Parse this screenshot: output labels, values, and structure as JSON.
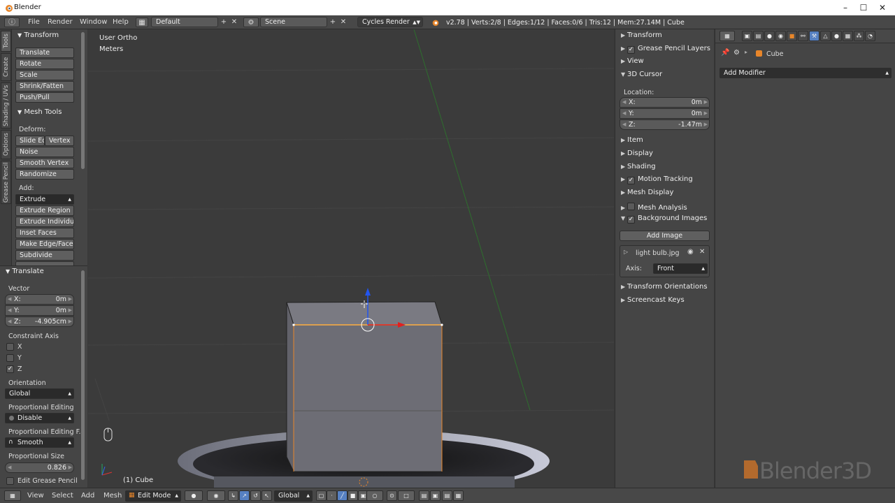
{
  "window": {
    "title": "Blender"
  },
  "infobar": {
    "menus": [
      "File",
      "Render",
      "Window",
      "Help"
    ],
    "layout": "Default",
    "scene": "Scene",
    "engine": "Cycles Render",
    "stats": "v2.78 | Verts:2/8 | Edges:1/12 | Faces:0/6 | Tris:12 | Mem:27.14M | Cube"
  },
  "tabs": [
    "Tools",
    "Create",
    "Shading / UVs",
    "Options",
    "Grease Pencil"
  ],
  "toolshelf": {
    "transform_title": "Transform",
    "transform_buttons": [
      "Translate",
      "Rotate",
      "Scale",
      "Shrink/Fatten",
      "Push/Pull"
    ],
    "mesh_tools_title": "Mesh Tools",
    "deform_label": "Deform:",
    "slide_edge": "Slide Ed",
    "vertex": "Vertex",
    "deform_buttons": [
      "Noise",
      "Smooth Vertex",
      "Randomize"
    ],
    "add_label": "Add:",
    "extrude": "Extrude",
    "add_buttons": [
      "Extrude Region",
      "Extrude Individual",
      "Inset Faces",
      "Make Edge/Face",
      "Subdivide"
    ]
  },
  "operator": {
    "title": "Translate",
    "vector_label": "Vector",
    "x_label": "X:",
    "x_value": "0m",
    "y_label": "Y:",
    "y_value": "0m",
    "z_label": "Z:",
    "z_value": "-4.905cm",
    "constraint_label": "Constraint Axis",
    "axes": [
      {
        "label": "X",
        "checked": false
      },
      {
        "label": "Y",
        "checked": false
      },
      {
        "label": "Z",
        "checked": true
      }
    ],
    "orientation_label": "Orientation",
    "orientation_value": "Global",
    "prop_edit_label": "Proportional Editing",
    "prop_edit_value": "Disable",
    "prop_falloff_label": "Proportional Editing F...",
    "prop_falloff_value": "Smooth",
    "prop_size_label": "Proportional Size",
    "prop_size_value": "0.826",
    "grease_label": "Edit Grease Pencil"
  },
  "viewport": {
    "view_name": "User Ortho",
    "units": "Meters",
    "object_label": "(1) Cube"
  },
  "npanel": {
    "transform": "Transform",
    "grease_layers": "Grease Pencil Layers",
    "view": "View",
    "cursor": "3D Cursor",
    "location_label": "Location:",
    "cx_label": "X:",
    "cx": "0m",
    "cy_label": "Y:",
    "cy": "0m",
    "cz_label": "Z:",
    "cz": "-1.47m",
    "item": "Item",
    "display": "Display",
    "shading": "Shading",
    "motion_tracking": "Motion Tracking",
    "mesh_display": "Mesh Display",
    "mesh_analysis": "Mesh Analysis",
    "background_images": "Background Images",
    "add_image": "Add Image",
    "image_name": "light bulb.jpg",
    "axis_label": "Axis:",
    "axis_value": "Front",
    "transform_orientations": "Transform Orientations",
    "screencast_keys": "Screencast Keys"
  },
  "properties": {
    "object_name": "Cube",
    "add_modifier": "Add Modifier"
  },
  "bottombar": {
    "menus": [
      "View",
      "Select",
      "Add",
      "Mesh"
    ],
    "mode": "Edit Mode",
    "orientation": "Global"
  },
  "watermark": "Blender3D",
  "colors": {
    "accent": "#e8862a",
    "selected_tab": "#5680c2"
  }
}
